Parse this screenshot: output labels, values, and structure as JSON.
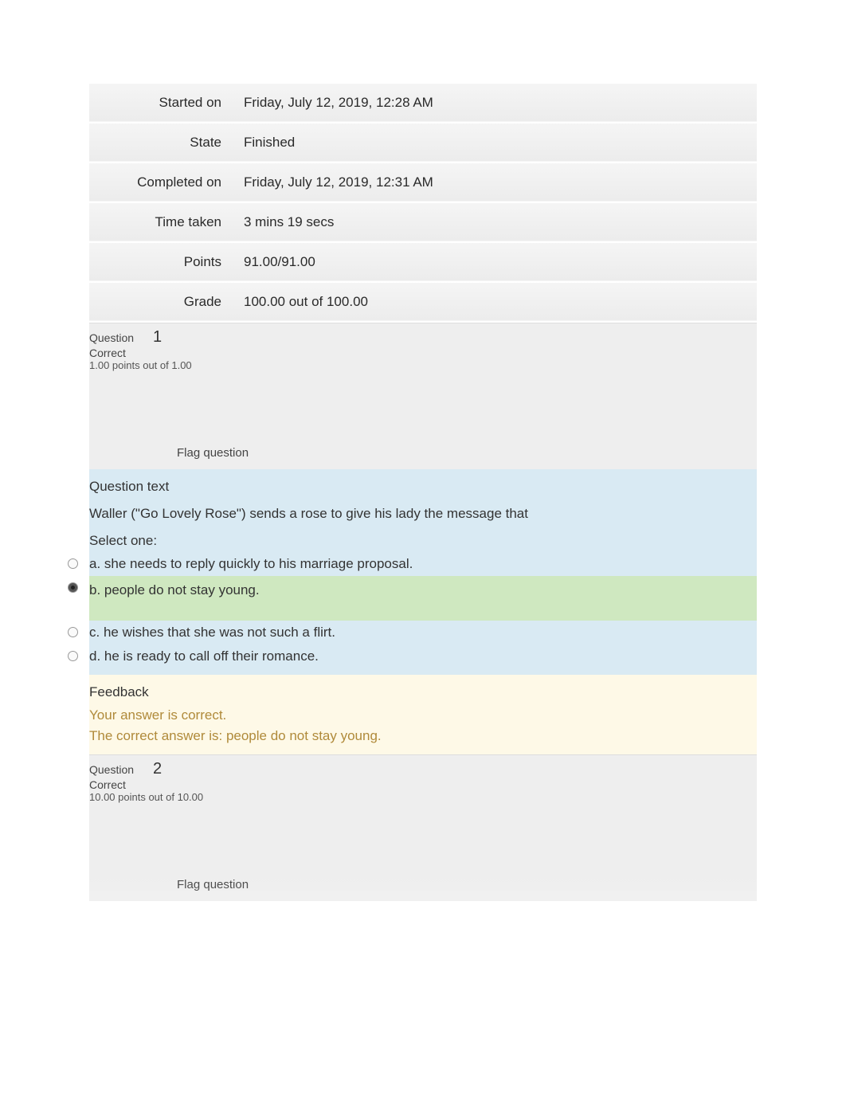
{
  "summary": {
    "rows": [
      {
        "label": "Started on",
        "value": "Friday, July 12, 2019, 12:28 AM"
      },
      {
        "label": "State",
        "value": "Finished"
      },
      {
        "label": "Completed on",
        "value": "Friday, July 12, 2019, 12:31 AM"
      },
      {
        "label": "Time taken",
        "value": "3 mins 19 secs"
      },
      {
        "label": "Points",
        "value": "91.00/91.00"
      },
      {
        "label": "Grade",
        "value": "100.00  out of 100.00"
      }
    ]
  },
  "q1": {
    "label": "Question",
    "number": "1",
    "status": "Correct",
    "points": "1.00 points out of 1.00",
    "flag": "Flag question",
    "qtext_heading": "Question text",
    "prompt": "Waller (\"Go Lovely Rose\") sends a rose to give his lady the message that",
    "select": "Select one:",
    "options": {
      "a": "a. she needs to reply quickly to his marriage proposal.",
      "b": "b. people do not stay young.",
      "c": "c. he wishes that she was not such a flirt.",
      "d": "d. he is ready to call off their romance."
    },
    "feedback_heading": "Feedback",
    "your_correct": "Your answer is correct.",
    "correct_answer": "The correct answer is: people do not stay young."
  },
  "q2": {
    "label": "Question",
    "number": "2",
    "status": "Correct",
    "points": "10.00 points out of 10.00",
    "flag": "Flag question"
  }
}
